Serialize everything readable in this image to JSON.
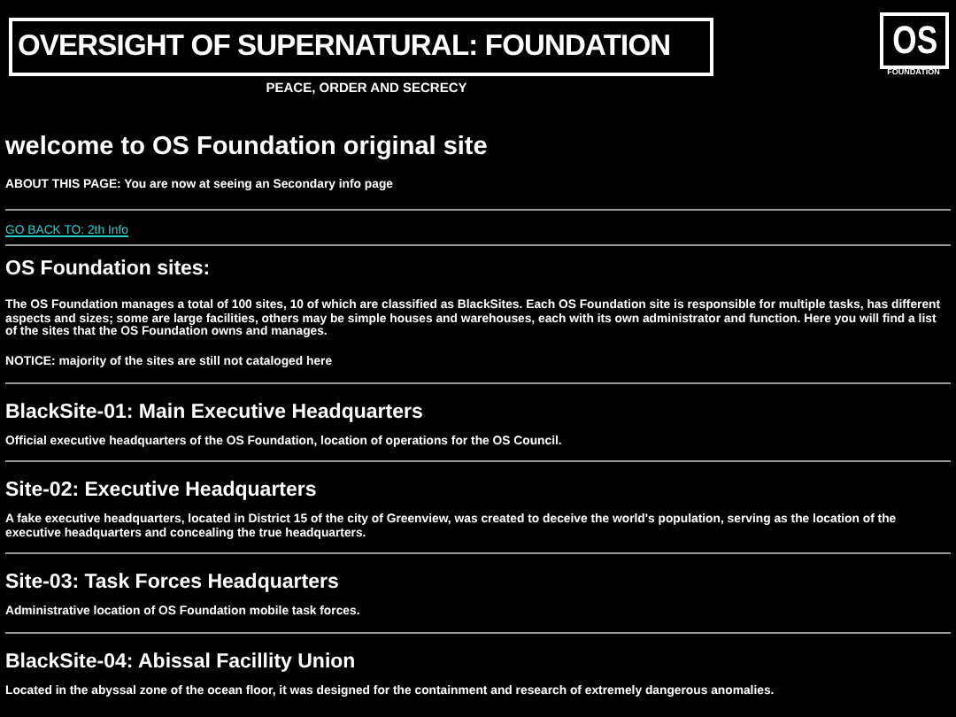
{
  "header": {
    "title": "OVERSIGHT OF SUPERNATURAL: FOUNDATION",
    "tagline": "PEACE, ORDER AND SECRECY",
    "logo": {
      "mark": "OS",
      "caption": "FOUNDATION"
    }
  },
  "welcome": "welcome to OS Foundation original site",
  "about": "ABOUT THIS PAGE: You are now at seeing an Secondary info page",
  "back_link": "GO BACK TO: 2th Info",
  "intro": {
    "heading": "OS Foundation sites:",
    "text": "The OS Foundation manages a total of 100 sites, 10 of which are classified as BlackSites. Each OS Foundation site is responsible for multiple tasks, has different aspects and sizes; some are large facilities, others may be simple houses and warehouses, each with its own administrator and function. Here you will find a list of the sites that the OS Foundation owns and manages.",
    "notice": "NOTICE: majority of the sites are still not cataloged here"
  },
  "sites": [
    {
      "name": "BlackSite-01: Main Executive Headquarters",
      "description": "Official executive headquarters of the OS Foundation, location of operations for the OS Council."
    },
    {
      "name": "Site-02: Executive Headquarters",
      "description": "A fake executive headquarters, located in District 15 of the city of Greenview, was created to deceive the world's population, serving as the location of the executive headquarters and concealing the true headquarters."
    },
    {
      "name": "Site-03: Task Forces Headquarters",
      "description": "Administrative location of OS Foundation mobile task forces."
    },
    {
      "name": "BlackSite-04: Abissal Facillity Union",
      "description": "Located in the abyssal zone of the ocean floor, it was designed for the containment and research of extremely dangerous anomalies."
    }
  ]
}
